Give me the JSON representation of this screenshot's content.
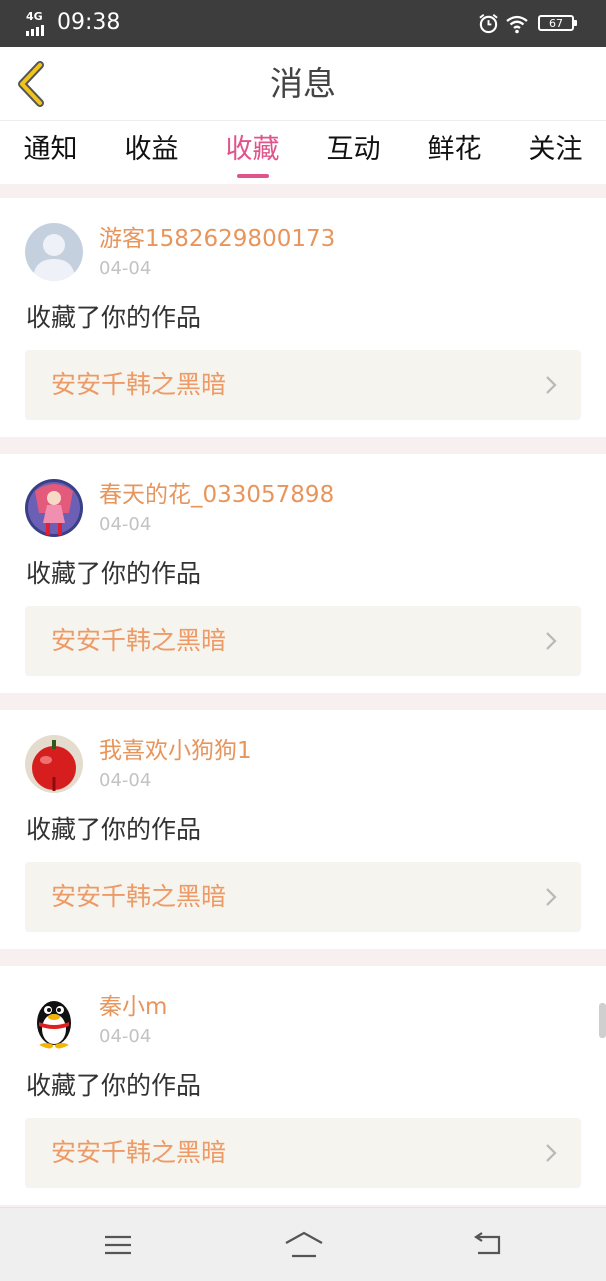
{
  "status_bar": {
    "network": "4G",
    "time": "09:38",
    "battery": "67",
    "icons": [
      "signal-icon",
      "alarm-icon",
      "wifi-icon",
      "battery-icon"
    ]
  },
  "header": {
    "title": "消息",
    "back_icon": "chevron-left-icon"
  },
  "tabs": [
    {
      "label": "通知",
      "active": false
    },
    {
      "label": "收益",
      "active": false
    },
    {
      "label": "收藏",
      "active": true
    },
    {
      "label": "互动",
      "active": false
    },
    {
      "label": "鲜花",
      "active": false
    },
    {
      "label": "关注",
      "active": false
    }
  ],
  "messages": [
    {
      "username": "游客1582629800173",
      "date": "04-04",
      "text": "收藏了你的作品",
      "work_title": "安安千韩之黑暗",
      "avatar": "default-user-avatar"
    },
    {
      "username": "春天的花_033057898",
      "date": "04-04",
      "text": "收藏了你的作品",
      "work_title": "安安千韩之黑暗",
      "avatar": "anime-character-avatar"
    },
    {
      "username": "我喜欢小狗狗1",
      "date": "04-04",
      "text": "收藏了你的作品",
      "work_title": "安安千韩之黑暗",
      "avatar": "red-apple-avatar"
    },
    {
      "username": "秦小m",
      "date": "04-04",
      "text": "收藏了你的作品",
      "work_title": "安安千韩之黑暗",
      "avatar": "penguin-avatar"
    }
  ],
  "nav_bar": {
    "icons": [
      "menu-icon",
      "home-icon",
      "back-icon"
    ]
  },
  "colors": {
    "accent": "#e0548c",
    "username": "#e8955c",
    "work_title": "#ed9a66",
    "back_arrow": "#f0c419"
  }
}
